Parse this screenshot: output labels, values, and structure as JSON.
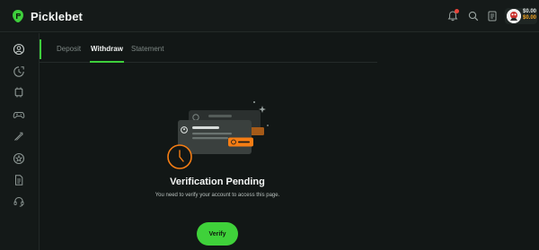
{
  "app": {
    "brand_name": "Picklebet"
  },
  "header": {
    "icons": [
      "notification-bell-icon",
      "search-icon",
      "betslip-icon"
    ],
    "balance_primary": "$0.00",
    "balance_bonus": "$0.00",
    "colors": {
      "accent": "#3ecf3c",
      "bonus": "#f5a623",
      "notification": "#e8443a"
    }
  },
  "sidebar": {
    "items": [
      {
        "icon": "account-icon"
      },
      {
        "icon": "live-icon"
      },
      {
        "icon": "esports-icon"
      },
      {
        "icon": "gamepad-icon"
      },
      {
        "icon": "racing-icon"
      },
      {
        "icon": "promotions-icon"
      },
      {
        "icon": "betslip-history-icon"
      },
      {
        "icon": "support-icon"
      }
    ]
  },
  "tabs": [
    {
      "label": "Deposit",
      "active": false
    },
    {
      "label": "Withdraw",
      "active": true
    },
    {
      "label": "Statement",
      "active": false
    }
  ],
  "verification": {
    "title": "Verification Pending",
    "message": "You need to verify your account to access this page.",
    "button_label": "Verify"
  }
}
